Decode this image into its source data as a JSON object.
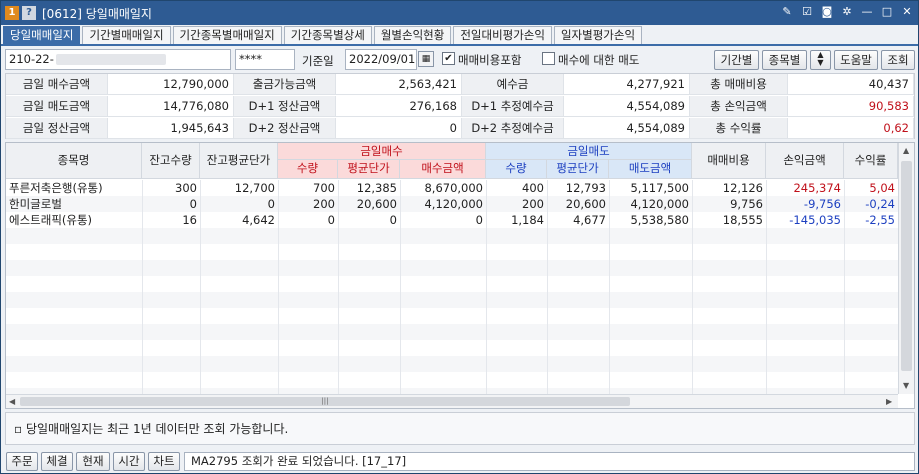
{
  "title": {
    "code": "[0612]",
    "name": "당일매매일지",
    "badge1": "1",
    "badge2": "?"
  },
  "icons": [
    "memo-icon",
    "check-icon",
    "camera-icon",
    "gear-icon",
    "minimize-icon",
    "maximize-icon",
    "close-icon"
  ],
  "tabs": [
    "당일매매일지",
    "기간별매매일지",
    "기간종목별매매일지",
    "기간종목별상세",
    "월별손익현황",
    "전일대비평가손익",
    "일자별평가손익"
  ],
  "search": {
    "account": "210-22-",
    "password": "****",
    "date_label": "기준일",
    "date": "2022/09/01",
    "fee_include_label": "매매비용포함",
    "fee_include_checked": "✔",
    "sell_for_buy_label": "매수에 대한 매도",
    "sell_for_buy_checked": "",
    "btn_period": "기간별",
    "btn_stock": "종목별",
    "btn_help": "도움말",
    "btn_query": "조회"
  },
  "summary": [
    [
      {
        "l": "금일 매수금액",
        "v": "12,790,000"
      },
      {
        "l": "출금가능금액",
        "v": "2,563,421"
      },
      {
        "l": "예수금",
        "v": "4,277,921"
      },
      {
        "l": "총 매매비용",
        "v": "40,437"
      }
    ],
    [
      {
        "l": "금일 매도금액",
        "v": "14,776,080"
      },
      {
        "l": "D+1 정산금액",
        "v": "276,168"
      },
      {
        "l": "D+1 추정예수금",
        "v": "4,554,089"
      },
      {
        "l": "총 손익금액",
        "v": "90,583"
      }
    ],
    [
      {
        "l": "금일 정산금액",
        "v": "1,945,643"
      },
      {
        "l": "D+2 정산금액",
        "v": "0"
      },
      {
        "l": "D+2 추정예수금",
        "v": "4,554,089"
      },
      {
        "l": "총 수익률",
        "v": "0,62"
      }
    ]
  ],
  "grid": {
    "headers": {
      "name": "종목명",
      "qty": "잔고수량",
      "avg": "잔고평균단가",
      "buy_group": "금일매수",
      "buy_qty": "수량",
      "buy_avg": "평균단가",
      "buy_amt": "매수금액",
      "sell_group": "금일매도",
      "sell_qty": "수량",
      "sell_avg": "평균단가",
      "sell_amt": "매도금액",
      "fee": "매매비용",
      "pnl": "손익금액",
      "rate": "수익률"
    },
    "rows": [
      {
        "name": "푸른저축은행(유통)",
        "qty": "300",
        "avg": "12,700",
        "buy_qty": "700",
        "buy_avg": "12,385",
        "buy_amt": "8,670,000",
        "sell_qty": "400",
        "sell_avg": "12,793",
        "sell_amt": "5,117,500",
        "fee": "12,126",
        "pnl": "245,374",
        "rate": "5,04"
      },
      {
        "name": "한미글로벌",
        "qty": "0",
        "avg": "0",
        "buy_qty": "200",
        "buy_avg": "20,600",
        "buy_amt": "4,120,000",
        "sell_qty": "200",
        "sell_avg": "20,600",
        "sell_amt": "4,120,000",
        "fee": "9,756",
        "pnl": "-9,756",
        "rate": "-0,24"
      },
      {
        "name": "에스트래픽(유통)",
        "qty": "16",
        "avg": "4,642",
        "buy_qty": "0",
        "buy_avg": "0",
        "buy_amt": "0",
        "sell_qty": "1,184",
        "sell_avg": "4,677",
        "sell_amt": "5,538,580",
        "fee": "18,555",
        "pnl": "-145,035",
        "rate": "-2,55"
      }
    ]
  },
  "note": "당일매매일지는 최근 1년 데이터만 조회 가능합니다.",
  "statusbar": {
    "btn_order": "주문",
    "btn_fill": "체결",
    "btn_price": "현재",
    "btn_time": "시간",
    "btn_chart": "차트",
    "message": "MA2795 조회가 완료 되었습니다. [17_17]"
  },
  "colors": {
    "title_bg": "#2e5b93",
    "tab_active": "#3c6ca8",
    "buy_header": "#fbdada",
    "sell_header": "#d9e7f7",
    "positive": "#c0101a",
    "negative": "#1c3fc0"
  }
}
